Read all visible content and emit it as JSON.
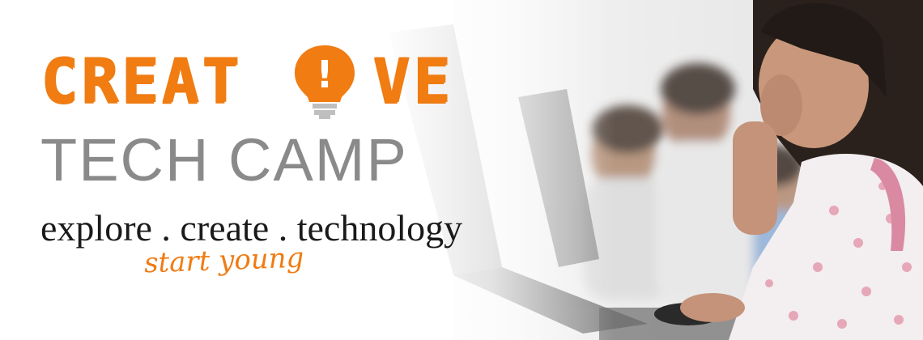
{
  "banner": {
    "logo": {
      "word_part_a": "CREAT",
      "word_part_b": "VE",
      "bulb_glyph": "!",
      "subtitle": "TECH CAMP",
      "tagline": "explore . create . technology",
      "subline": "start young"
    },
    "icons": {
      "bulb": "lightbulb-icon"
    },
    "colors": {
      "accent": "#f07c12",
      "subtitle": "#8a8a8a",
      "text": "#1a1a1a",
      "bulb_base": "#bfbfbf"
    }
  }
}
